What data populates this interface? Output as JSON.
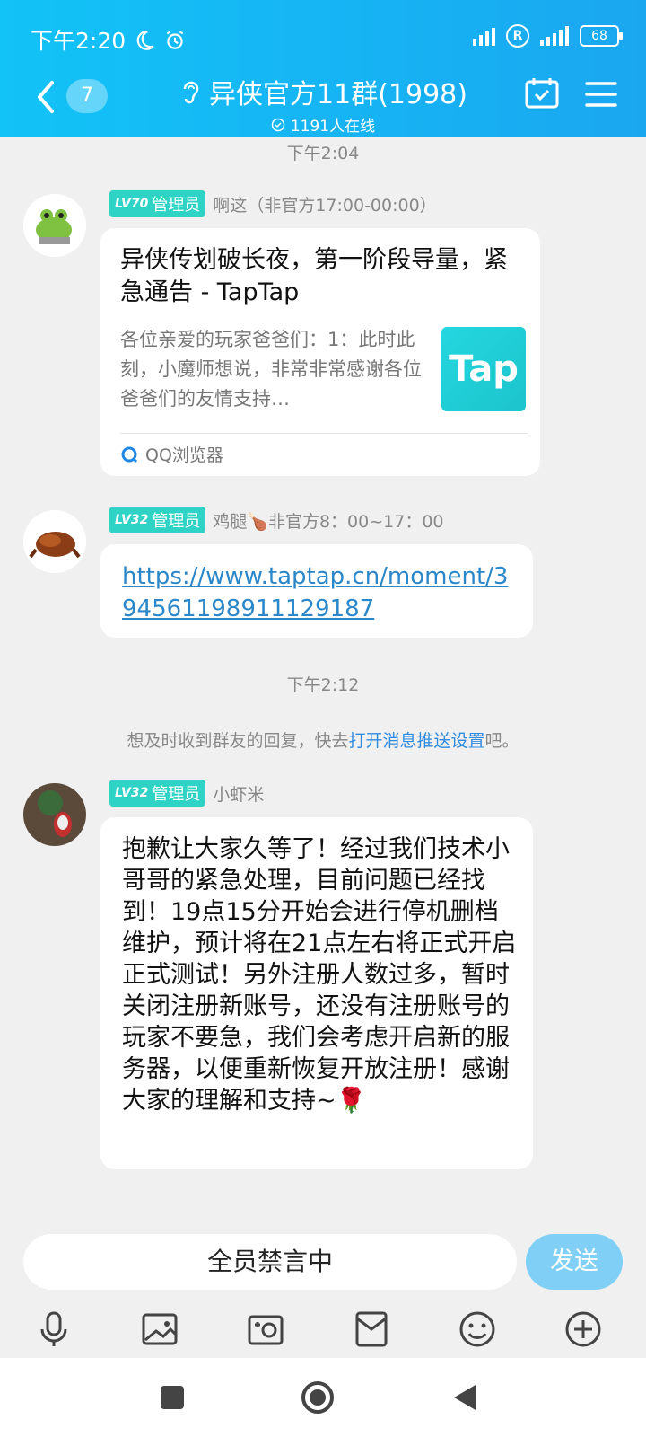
{
  "status_bar": {
    "time": "下午2:20",
    "battery": "68"
  },
  "nav": {
    "unread_count": "7",
    "title": "异侠官方11群(1998)",
    "online": "1191人在线"
  },
  "messages": [
    {
      "time": "下午2:04",
      "level": "LV70",
      "role": "管理员",
      "sender": "啊这（非官方17:00-00:00）",
      "card": {
        "title": "异侠传划破长夜，第一阶段导量，紧急通告 - TapTap",
        "desc": "各位亲爱的玩家爸爸们：1：此时此刻，小魔师想说，非常非常感谢各位爸爸们的友情支持…",
        "logo": "Tap",
        "source": "QQ浏览器"
      }
    },
    {
      "level": "LV32",
      "role": "管理员",
      "sender": "鸡腿🍗非官方8：00~17：00",
      "link": "https://www.taptap.cn/moment/394561198911129187"
    },
    {
      "time": "下午2:12",
      "notice_prefix": "想及时收到群友的回复，快去",
      "notice_link": "打开消息推送设置",
      "notice_suffix": "吧。",
      "level": "LV32",
      "role": "管理员",
      "sender": "小虾米",
      "text": "抱歉让大家久等了！经过我们技术小哥哥的紧急处理，目前问题已经找到！19点15分开始会进行停机删档维护，预计将在21点左右将正式开启正式测试！另外注册人数过多，暂时关闭注册新账号，还没有注册账号的玩家不要急，我们会考虑开启新的服务器，以便重新恢复开放注册！感谢大家的理解和支持~🌹"
    }
  ],
  "input": {
    "muted_text": "全员禁言中",
    "send_label": "发送"
  },
  "tools": [
    "microphone-icon",
    "image-icon",
    "camera-icon",
    "red-packet-icon",
    "emoji-icon",
    "plus-icon"
  ]
}
